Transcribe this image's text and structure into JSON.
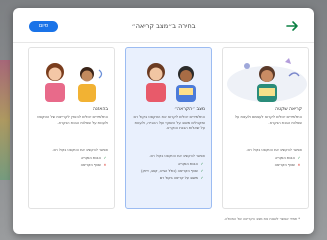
{
  "dialog": {
    "title": "בחירה ב״מצב קריאה״",
    "confirm_label": "סיום",
    "back_icon": "arrow-right-icon",
    "colors": {
      "accent": "#1a73e8",
      "selected_card": "#e9f0fd",
      "check": "#188038",
      "cross": "#d93025"
    }
  },
  "cards": [
    {
      "title": "קריאה שקטה",
      "desc": "התלמידים יכולים לקרוא לעצמם ולענות על שאלות הבנת הנקרא.",
      "sub": "אפשר להקשיב את הטקסט בקול רם.",
      "rows": [
        {
          "mark": "✓",
          "text": "הבנת הנקרא"
        },
        {
          "mark": "✕",
          "text": "שטף הקריאה"
        }
      ],
      "selected": false
    },
    {
      "title": "מצב ״הקראה״",
      "desc": "התלמידים יכולים לקרוא את הטקסט בקול רם ומקבלים משוב על השטף ועל ההגייה, ולענות על שאלות הבנת הנקרא.",
      "sub": "אפשר להקשיב את הטקסט בקול רם.",
      "rows": [
        {
          "mark": "✓",
          "text": "הבנת הנקרא"
        },
        {
          "mark": "✓",
          "text": "שטף הקריאה (כולל הגייה, קצב, דיוק)"
        },
        {
          "mark": "✓",
          "text": "משוב על קריאה בקול רם"
        }
      ],
      "selected": true
    },
    {
      "title": "בהאזנה",
      "desc": "התלמידים יכולים להאזין לקריינות של הטקסט ולענות על שאלות הבנת הנקרא.",
      "sub": "אפשר להקשיב את הטקסט בקול רם.",
      "rows": [
        {
          "mark": "✓",
          "text": "הבנת הנקרא"
        },
        {
          "mark": "✕",
          "text": "שטף הקריאה"
        }
      ],
      "selected": false
    }
  ],
  "footer": {
    "note": "* תמיד אפשר לשנות את מצב הקריאה של המטלה."
  }
}
